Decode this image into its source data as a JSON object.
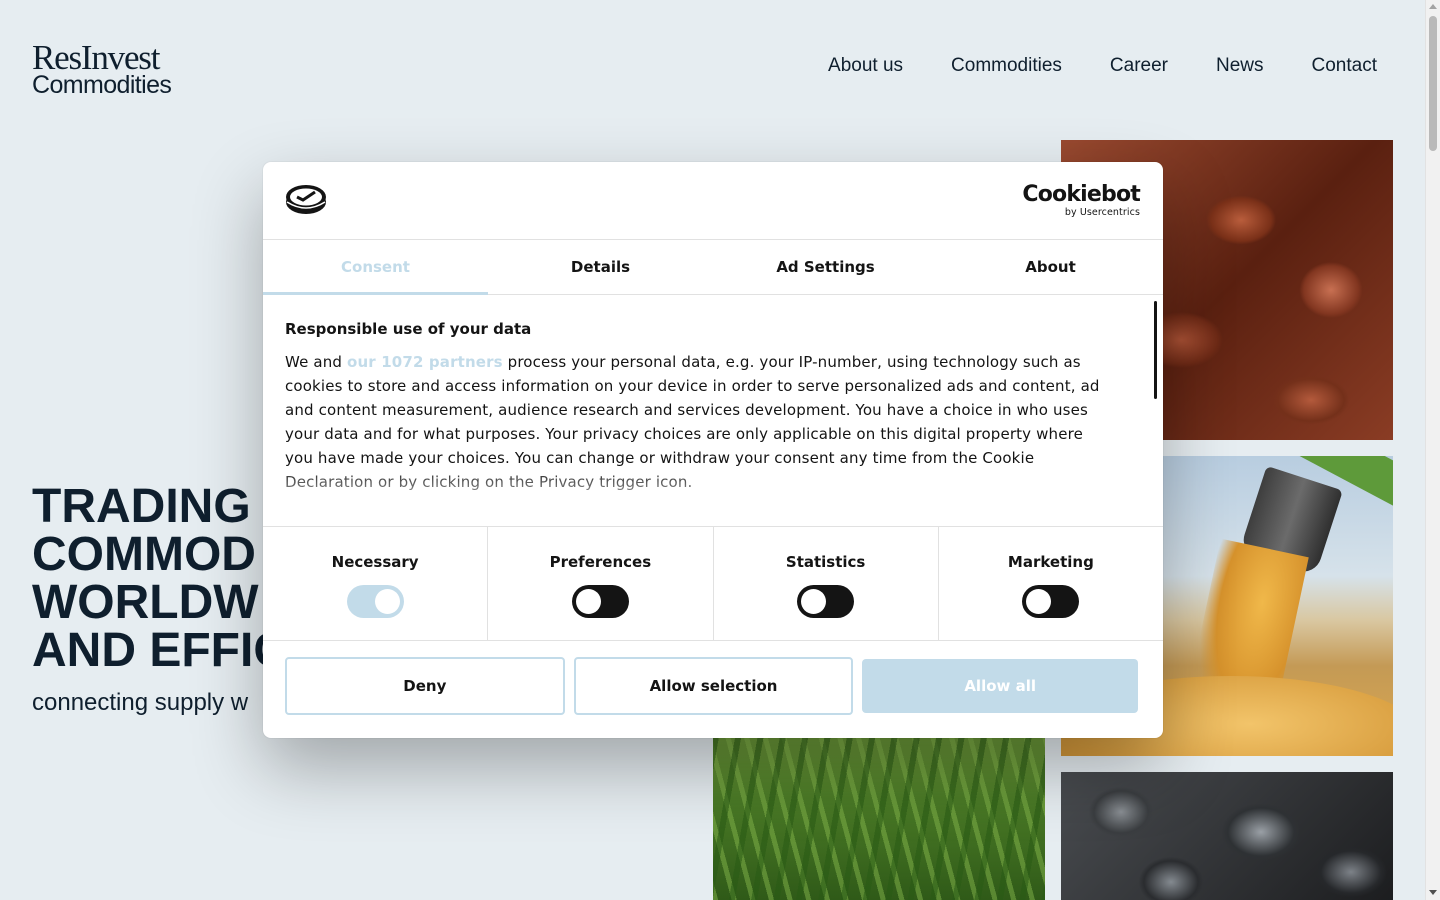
{
  "site": {
    "logo_line1": "ResInvest",
    "logo_line2": "Commodities",
    "nav": [
      "About us",
      "Commodities",
      "Career",
      "News",
      "Contact"
    ],
    "hero_lines": [
      "TRADING",
      "COMMOD",
      "WORLDW",
      "AND EFFIC"
    ],
    "hero_subtitle": "connecting supply w"
  },
  "cookie_dialog": {
    "brand": "Cookiebot",
    "brand_by": "by Usercentrics",
    "tabs": [
      "Consent",
      "Details",
      "Ad Settings",
      "About"
    ],
    "active_tab": "Consent",
    "title": "Responsible use of your data",
    "text_before_link": "We and ",
    "partners_link": "our 1072 partners",
    "text_after_link": " process your personal data, e.g. your IP-number, using technology such as cookies to store and access information on your device in order to serve personalized ads and content, ad and content measurement, audience research and services development. You have a choice in who uses your data and for what purposes. Your privacy choices are only applicable on this digital property where you have made your choices. You can change or withdraw your consent any time from the Cookie Declaration or by clicking on the Privacy trigger icon.",
    "toggles": [
      {
        "label": "Necessary",
        "on": true
      },
      {
        "label": "Preferences",
        "on": false
      },
      {
        "label": "Statistics",
        "on": false
      },
      {
        "label": "Marketing",
        "on": false
      }
    ],
    "buttons": {
      "deny": "Deny",
      "allow_selection": "Allow selection",
      "allow_all": "Allow all"
    }
  },
  "colors": {
    "page_bg": "#e6edf1",
    "text_dark": "#0f1f2e",
    "accent": "#c2dbe9"
  },
  "images": [
    "iron-ore-photo",
    "corn-harvest-photo",
    "corn-field-photo",
    "coal-photo"
  ]
}
